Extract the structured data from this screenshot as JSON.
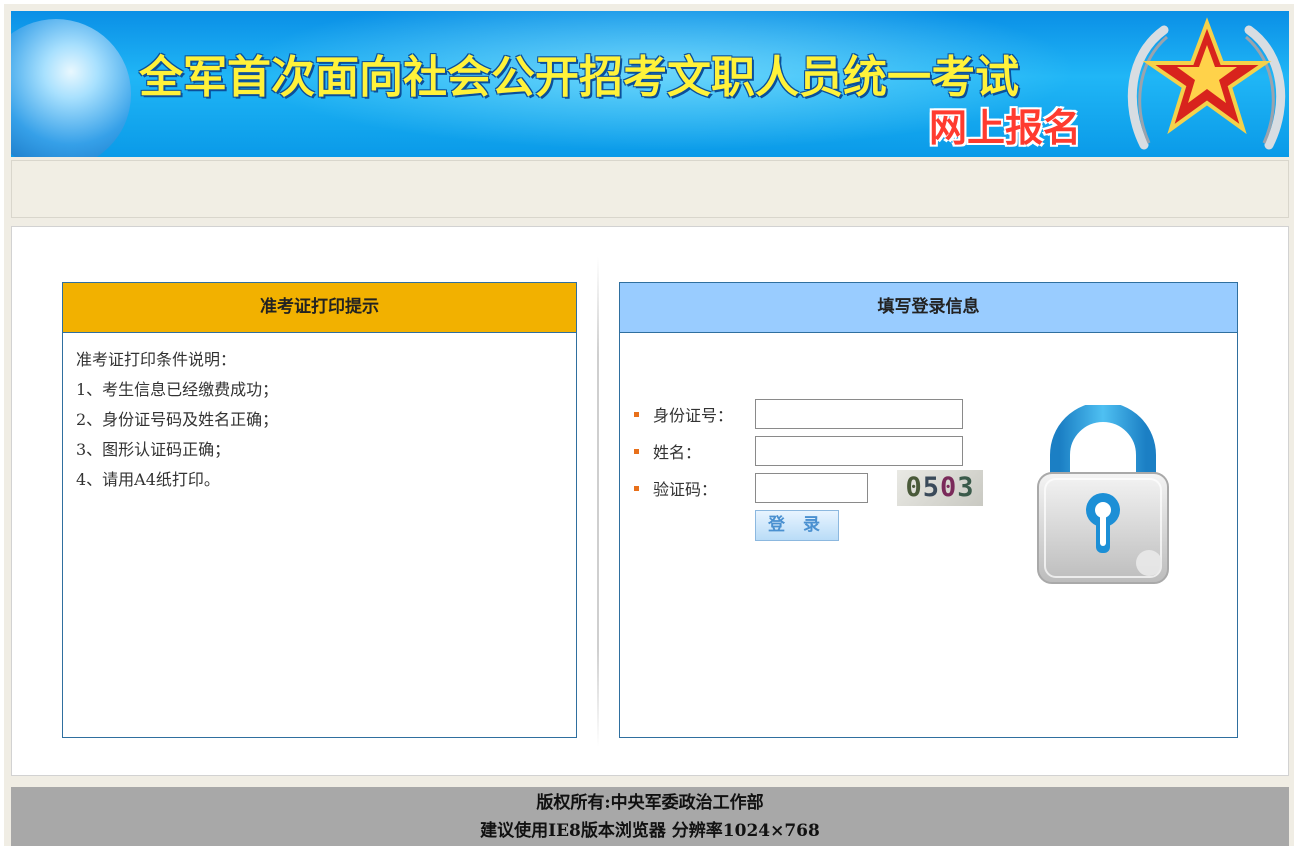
{
  "banner": {
    "title": "全军首次面向社会公开招考文职人员统一考试",
    "subtitle": "网上报名"
  },
  "left_panel": {
    "title": "准考证打印提示",
    "lines": [
      "准考证打印条件说明：",
      "1、考生信息已经缴费成功；",
      "2、身份证号码及姓名正确；",
      "3、图形认证码正确；",
      "4、请用A4纸打印。"
    ]
  },
  "right_panel": {
    "title": "填写登录信息",
    "id_label": "身份证号：",
    "id_value": "",
    "name_label": "姓名：",
    "name_value": "",
    "captcha_label": "验证码：",
    "captcha_value": "",
    "captcha_image_text": "0503",
    "login_label": "登 录"
  },
  "footer": {
    "line1": "版权所有:中央军委政治工作部",
    "line2": "建议使用IE8版本浏览器 分辨率1024×768"
  },
  "colors": {
    "left_header": "#f2b100",
    "right_header": "#99ccff",
    "panel_border": "#2f6f9f",
    "footer_bg": "#a8a8a8",
    "bullet": "#e8701a"
  }
}
